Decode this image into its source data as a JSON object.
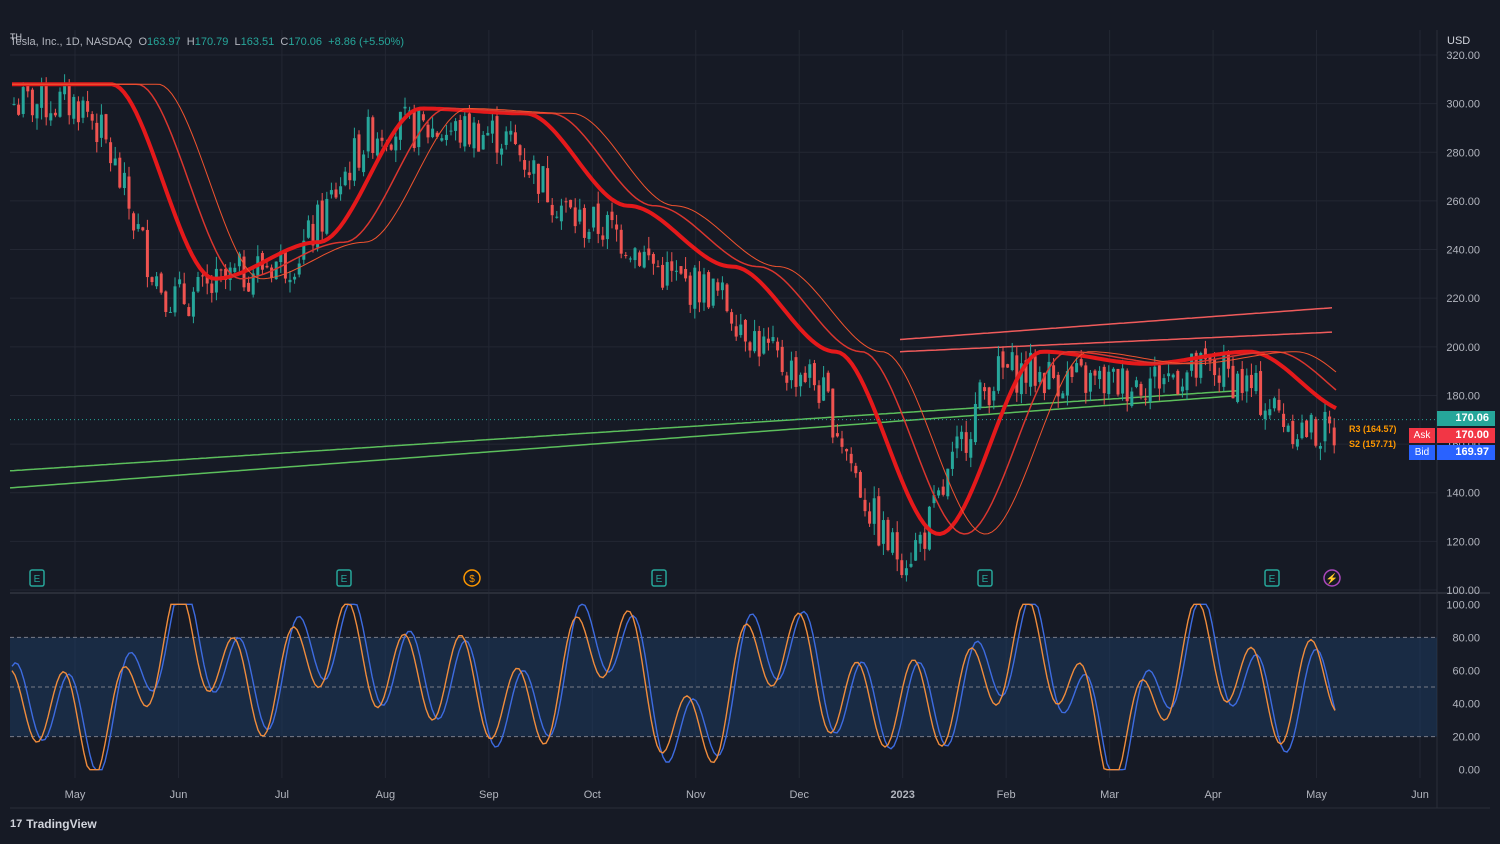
{
  "app": {
    "brand": "TradingView",
    "brand_logo": "17",
    "currency": "USD"
  },
  "symbol": {
    "short_name": "TH",
    "name": "Tesla, Inc.",
    "interval": "1D",
    "exchange": "NASDAQ",
    "open_label": "O",
    "open": "163.97",
    "high_label": "H",
    "high": "170.79",
    "low_label": "L",
    "low": "163.51",
    "close_label": "C",
    "close": "170.06",
    "change": "+8.86 (+5.50%)"
  },
  "price_tags": {
    "last": "170.06",
    "ask_label": "Ask",
    "ask": "170.00",
    "bid_label": "Bid",
    "bid": "169.97"
  },
  "pivot_labels": [
    "R3 (164.57)",
    "S2 (157.71)"
  ],
  "colors": {
    "background": "#161a25",
    "up": "#26a69a",
    "down": "#ef5350",
    "ma_red": "#e5191b",
    "ma_green": "#3dcc33",
    "band": "#1e3a5f",
    "stoch_k": "#3d6be0",
    "stoch_d": "#f08c3c",
    "ask": "#f23645",
    "bid": "#2962ff"
  },
  "event_icons": [
    "earnings-icon",
    "earnings-icon",
    "dividend-icon",
    "earnings-icon",
    "earnings-icon",
    "earnings-icon",
    "flash-icon"
  ],
  "chart_data": [
    {
      "type": "line",
      "title": "Tesla, Inc., 1D, NASDAQ",
      "xlabel": "",
      "ylabel": "",
      "x": [
        "May",
        "Jun",
        "Jul",
        "Aug",
        "Sep",
        "Oct",
        "Nov",
        "Dec",
        "2023",
        "Feb",
        "Mar",
        "Apr",
        "May",
        "Jun"
      ],
      "series": [
        {
          "values": [
            300,
            220,
            235,
            290,
            288,
            250,
            225,
            190,
            115,
            190,
            185,
            190,
            165,
            null
          ]
        }
      ],
      "y_ticks": [
        "320.00",
        "300.00",
        "280.00",
        "260.00",
        "240.00",
        "220.00",
        "200.00",
        "180.00",
        "160.00",
        "140.00",
        "120.00",
        "100.00"
      ],
      "ylim": [
        100,
        320
      ],
      "grid": true
    },
    {
      "type": "line",
      "title": "",
      "xlabel": "",
      "ylabel": "",
      "x": [
        "May",
        "Jun",
        "Jul",
        "Aug",
        "Sep",
        "Oct",
        "Nov",
        "Dec",
        "2023",
        "Feb",
        "Mar",
        "Apr",
        "May",
        "Jun"
      ],
      "series": [
        {
          "values": [
            15,
            95,
            70,
            98,
            20,
            95,
            15,
            98,
            5,
            98,
            10,
            85,
            30,
            null
          ]
        },
        {
          "values": [
            12,
            88,
            65,
            92,
            25,
            88,
            18,
            90,
            8,
            95,
            12,
            80,
            45,
            null
          ]
        }
      ],
      "y_ticks": [
        "100.00",
        "80.00",
        "60.00",
        "40.00",
        "20.00",
        "0.00"
      ],
      "band": [
        20,
        80
      ],
      "ylim": [
        -5,
        105
      ],
      "grid": true
    }
  ]
}
